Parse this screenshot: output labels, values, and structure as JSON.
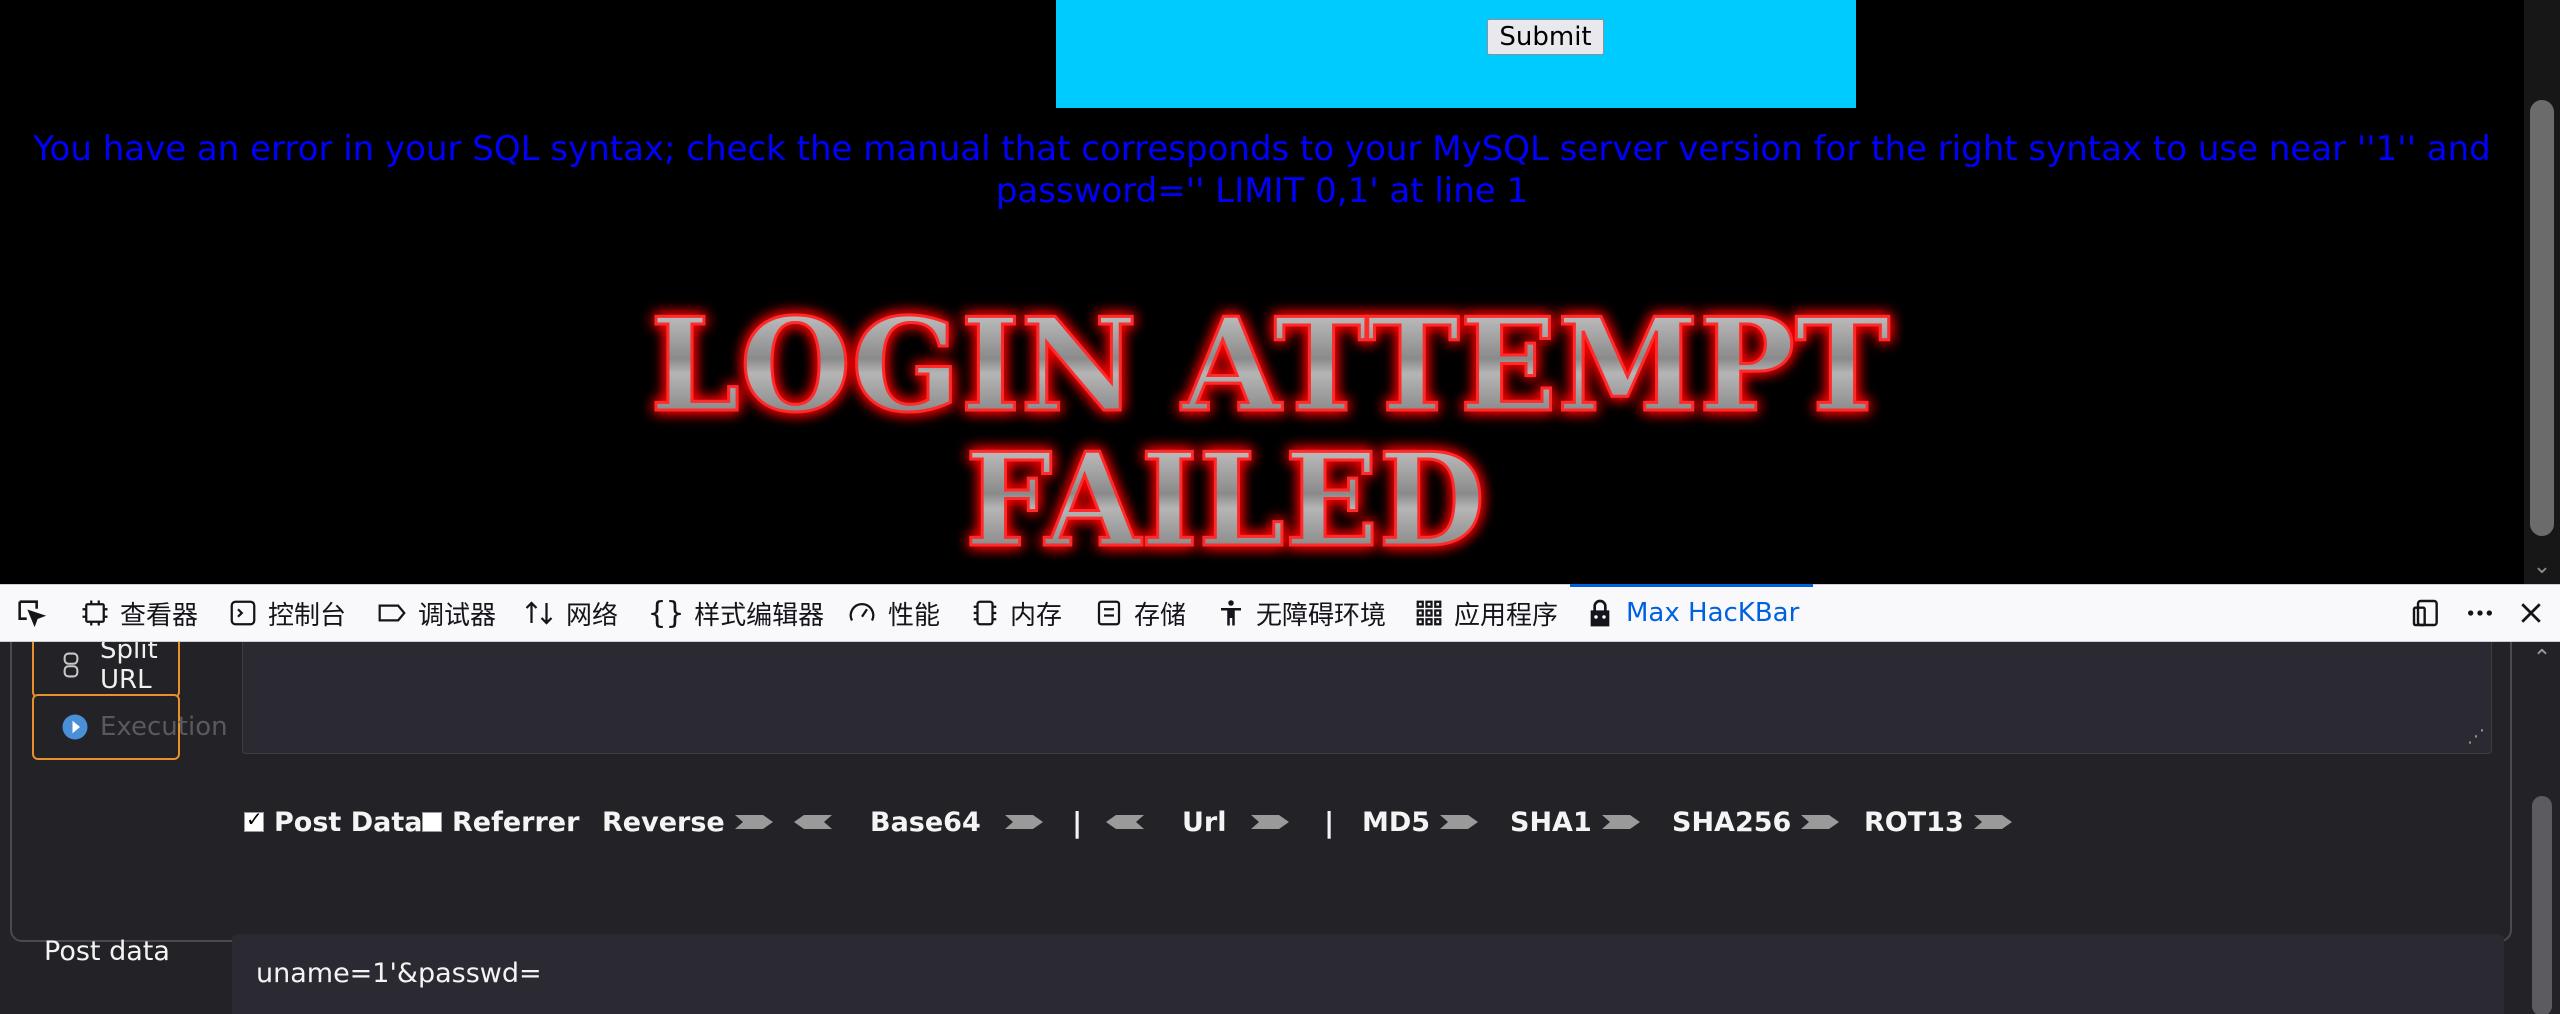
{
  "page": {
    "submit_label": "Submit",
    "error_message": "You have an error in your SQL syntax; check the manual that corresponds to your MySQL server version for the right syntax to use near ''1'' and password='' LIMIT 0,1' at line 1",
    "banner_line1": "LOGIN ATTEMPT",
    "banner_line2": "FAILED"
  },
  "devtools": {
    "tabs": [
      {
        "label": "查看器",
        "icon": "inspector-icon"
      },
      {
        "label": "控制台",
        "icon": "console-icon"
      },
      {
        "label": "调试器",
        "icon": "debugger-icon"
      },
      {
        "label": "网络",
        "icon": "network-icon"
      },
      {
        "label": "样式编辑器",
        "icon": "style-editor-icon"
      },
      {
        "label": "性能",
        "icon": "performance-icon"
      },
      {
        "label": "内存",
        "icon": "memory-icon"
      },
      {
        "label": "存储",
        "icon": "storage-icon"
      },
      {
        "label": "无障碍环境",
        "icon": "accessibility-icon"
      },
      {
        "label": "应用程序",
        "icon": "application-icon"
      },
      {
        "label": "Max HacKBar",
        "icon": "hackbar-icon",
        "active": true
      }
    ],
    "accent_color": "#0061e0"
  },
  "hackbar": {
    "split_url_label": "Split URL",
    "execution_label": "Execution",
    "toolbar": {
      "post_data_label": "Post Data",
      "post_data_checked": true,
      "referrer_label": "Referrer",
      "referrer_checked": false,
      "reverse_label": "Reverse",
      "base64_label": "Base64",
      "separator": "|",
      "url_label": "Url",
      "md5_label": "MD5",
      "sha1_label": "SHA1",
      "sha256_label": "SHA256",
      "rot13_label": "ROT13"
    },
    "post_data": {
      "label": "Post data",
      "value": "uname=1'&passwd="
    },
    "button_border_color": "#e6912b"
  }
}
